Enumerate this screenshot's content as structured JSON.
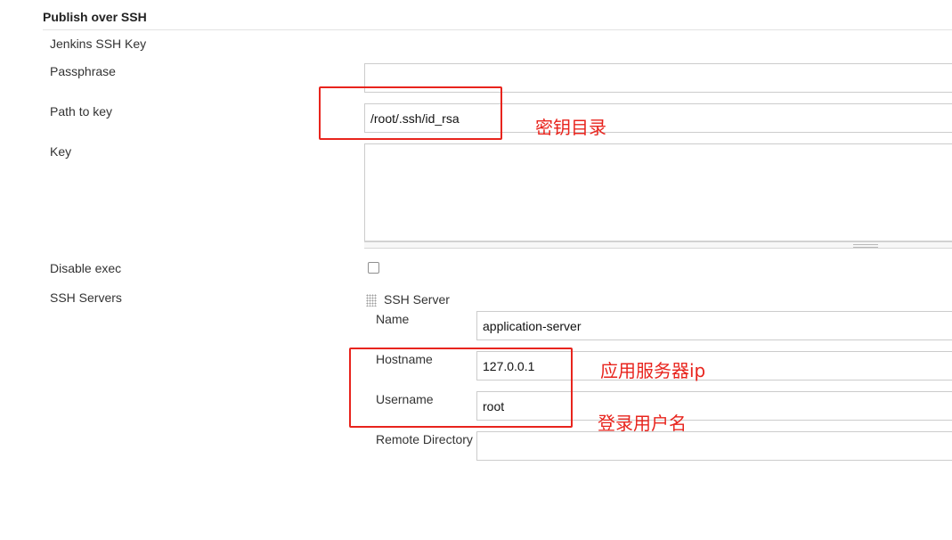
{
  "section": {
    "title": "Publish over SSH",
    "subheading": "Jenkins SSH Key"
  },
  "ssh_key": {
    "passphrase_label": "Passphrase",
    "passphrase_value": "",
    "path_label": "Path to key",
    "path_value": "/root/.ssh/id_rsa",
    "key_label": "Key",
    "key_value": "",
    "disable_exec_label": "Disable exec",
    "disable_exec_checked": false
  },
  "ssh_servers": {
    "label": "SSH Servers",
    "server_header": "SSH Server",
    "name_label": "Name",
    "name_value": "application-server",
    "hostname_label": "Hostname",
    "hostname_value": "127.0.0.1",
    "username_label": "Username",
    "username_value": "root",
    "remote_dir_label": "Remote Directory",
    "remote_dir_value": ""
  },
  "annotations": {
    "key_dir": "密钥目录",
    "app_server_ip": "应用服务器ip",
    "login_user": "登录用户名",
    "color": "#e8241d"
  }
}
